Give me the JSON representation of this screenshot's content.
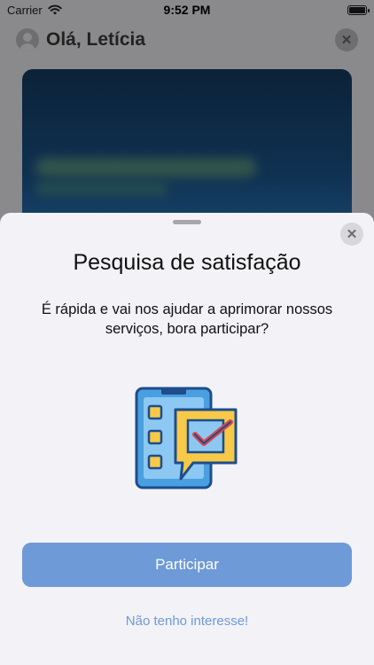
{
  "status_bar": {
    "carrier": "Carrier",
    "time": "9:52 PM"
  },
  "background": {
    "greeting": "Olá, Letícia"
  },
  "sheet": {
    "title": "Pesquisa de satisfação",
    "subtitle": "É rápida e vai nos ajudar a aprimorar nossos serviços, bora participar?",
    "primary_button": "Participar",
    "secondary_link": "Não tenho interesse!"
  },
  "icons": [
    "wifi-icon",
    "battery-icon",
    "avatar-icon",
    "close-icon",
    "survey-illustration"
  ],
  "colors": {
    "accent": "#6e9ad8",
    "sheet_background": "#f2f2f7"
  }
}
